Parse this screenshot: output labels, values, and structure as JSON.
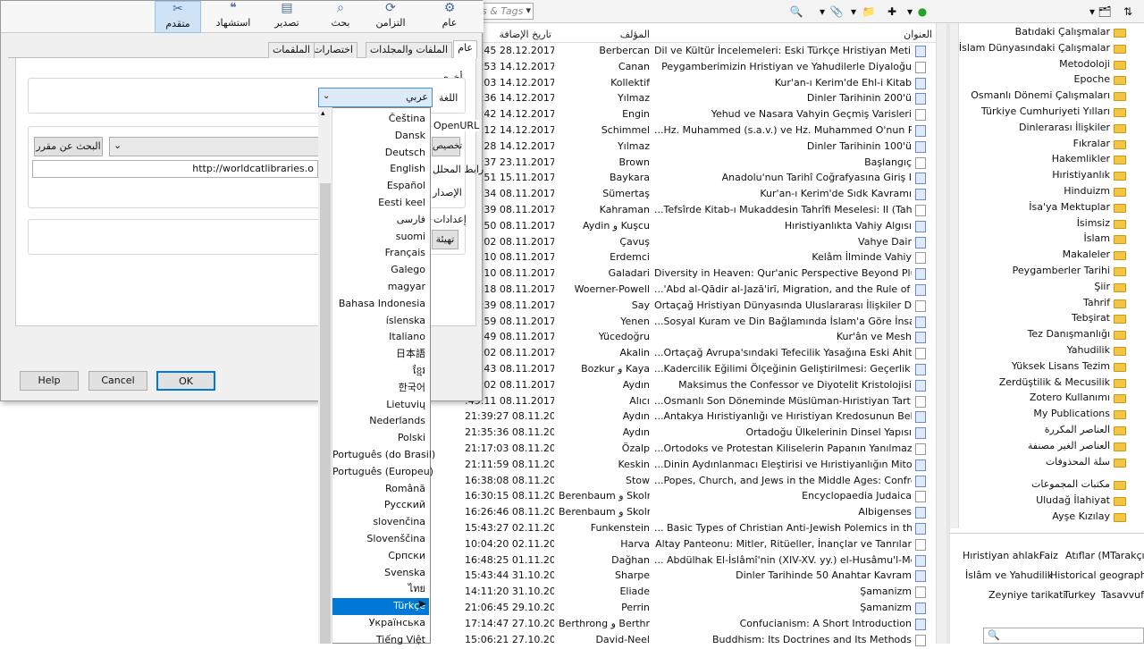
{
  "main": {
    "search_placeholder": "ds & Tags",
    "columns": {
      "title": "العنوان",
      "author": "المؤلف",
      "date_added": "تاريخ الإضافة"
    },
    "rows": [
      {
        "date": ":46:45 28.12.2017",
        "author": "Berbercan",
        "title": "Dil ve Kültür İncelemeleri: Eski Türkçe Hristiyan Metinleri"
      },
      {
        "date": ":01:53 14.12.2017",
        "author": "Canan",
        "title": "Peygamberimizin Hristiyan ve Yahudilerle Diyaloğu"
      },
      {
        "date": ":01:03 14.12.2017",
        "author": "Kollektif",
        "title": "Kur'an-ı Kerim'de Ehl-i Kitab"
      },
      {
        "date": ":00:36 14.12.2017",
        "author": "Yılmaz",
        "title": "Dinler Tarihinin 200'ü"
      },
      {
        "date": ":58:42 14.12.2017",
        "author": "Engin",
        "title": "Yehud ve Nasara Vahyin Geçmiş Varisleri"
      },
      {
        "date": ":57:12 14.12.2017",
        "author": "Schimmel",
        "title": "...Hz. Muhammed (s.a.v.) ve Hz. Muhammed O'nun Peygam"
      },
      {
        "date": ":55:28 14.12.2017",
        "author": "Yılmaz",
        "title": "Dinler Tarihinin 100'ü"
      },
      {
        "date": ":08:37 23.11.2017",
        "author": "Brown",
        "title": "Başlangıç"
      },
      {
        "date": ":21:51 15.11.2017",
        "author": "Baykara",
        "title": "Anadolu'nun Tarihî Coğrafyasına Giriş I"
      },
      {
        "date": ":01:34 08.11.2017",
        "author": "Sümertaş",
        "title": "Kur'an-ı Kerim'de Sıdk Kavramı"
      },
      {
        "date": ":58:39 08.11.2017",
        "author": "Kahraman",
        "title": "...Tefsîrde Kitab-ı Mukaddesin Tahrîfi Meselesi: II (Tahrîf Keli"
      },
      {
        "date": ":55:50 08.11.2017",
        "author": "Aydin و Kuşcu",
        "title": "Hıristiyanlıkta Vahiy Algısı"
      },
      {
        "date": ":55:02 08.11.2017",
        "author": "Çavuş",
        "title": "Vahye Dair"
      },
      {
        "date": ":53:10 08.11.2017",
        "author": "Erdemci",
        "title": "Kelâm İlminde Vahiy"
      },
      {
        "date": ":44:10 08.11.2017",
        "author": "Galadari",
        "title": "Diversity in Heaven: Qur'anic Perspective Beyond Pluralism"
      },
      {
        "date": ":43:18 08.11.2017",
        "author": "Woerner-Powell",
        "title": "...'Abd al-Qādir al-Jazā'irī, Migration, and the Rule of Law: 'A"
      },
      {
        "date": ":39:39 08.11.2017",
        "author": "Say",
        "title": "Ortaçağ Hristiyan Dünyasında Uluslararası İlişkiler Düşüncesi"
      },
      {
        "date": ":37:59 08.11.2017",
        "author": "Yenen",
        "title": "...Sosyal Kuram ve Din Bağlamında İslam'a Göre İnsanın Tem"
      },
      {
        "date": ":34:49 08.11.2017",
        "author": "Yücedoğru",
        "title": "Kur'ân ve Mesh"
      },
      {
        "date": ":31:02 08.11.2017",
        "author": "Akalin",
        "title": "...Ortaçağ Avrupa'sındaki Tefecilik Yasağına Eski Ahit Metinle"
      },
      {
        "date": ":48:43 08.11.2017",
        "author": "Bozkur و Kaya",
        "title": "...Kadercilik Eğilimi Ölçeğinin Geliştirilmesi: Geçerlik Ve Güve"
      },
      {
        "date": ":47:02 08.11.2017",
        "author": "Aydın",
        "title": "Maksimus the Confessor ve Diyotelit Kristolojisi"
      },
      {
        "date": ":45:11 08.11.2017",
        "author": "Alıcı",
        "title": "...Osmanlı Son Döneminde Müslüman-Hıristiyan Tartışmaları"
      },
      {
        "date": "21:39:27 08.11.2017",
        "author": "Aydın",
        "title": "...Antakya Hıristiyanlığı ve Hıristiyan Kredosunun Belirlenmesi"
      },
      {
        "date": "21:35:36 08.11.2017",
        "author": "Aydın",
        "title": "Ortadoğu Ülkelerinin Dinsel Yapısı"
      },
      {
        "date": "21:17:03 08.11.2017",
        "author": "Özalp",
        "title": "...Ortodoks ve Protestan Kiliselerin Papanın Yanılmazlığı Dokt"
      },
      {
        "date": "21:11:59 08.11.2017",
        "author": "Keskin",
        "title": "...Dinin Aydınlanmacı Eleştirisi ve Hıristiyanlığın Mitolojik Kar"
      },
      {
        "date": "16:38:08 08.11.2017",
        "author": "Stow",
        "title": "...Popes, Church, and Jews in the Middle Ages: Confrontation"
      },
      {
        "date": "16:30:15 08.11.2017",
        "author": "Berenbaum و Skolnik",
        "title": "Encyclopaedia Judaica"
      },
      {
        "date": "16:26:46 08.11.2017",
        "author": "Berenbaum و Skolnik",
        "title": "Albigenses"
      },
      {
        "date": "15:43:27 02.11.2017",
        "author": "Funkenstein",
        "title": "... Basic Types of Christian Anti-Jewish Polemics in the Later"
      },
      {
        "date": "10:04:20 02.11.2017",
        "author": "Harva",
        "title": "Altay Panteonu: Mitler, Ritüeller, İnançlar ve Tanrılar"
      },
      {
        "date": "16:48:25 01.11.2017",
        "author": "Dağhan",
        "title": "... Abdülhak El-İslâmî'nin (XIV-XV. yy.) el-Husâmu'l-Memdûd"
      },
      {
        "date": "15:43:44 31.10.2017",
        "author": "Sharpe",
        "title": "Dinler Tarihinde 50 Anahtar Kavram"
      },
      {
        "date": "14:11:20 31.10.2017",
        "author": "Eliade",
        "title": "Şamanizm"
      },
      {
        "date": "21:06:45 29.10.2017",
        "author": "Perrin",
        "title": "Şamanizm"
      },
      {
        "date": "17:14:47 27.10.2017",
        "author": "Berthrong و Berthrong",
        "title": "Confucianism: A Short Introduction"
      },
      {
        "date": "15:06:21 27.10.2017",
        "author": "David-Neel",
        "title": "Buddhism: Its Doctrines and Its Methods"
      }
    ],
    "collections": [
      "Batıdaki Çalışmalar",
      "İslam Dünyasındaki Çalışmalar",
      "Metodoloji",
      "Epoche",
      "Osmanlı Dönemi Çalışmaları",
      "Türkiye Cumhuriyeti Yılları",
      "Dinlerarası İlişkiler",
      "Fıkralar",
      "Hakemlikler",
      "Hıristiyanlık",
      "Hinduizm",
      "İsa'ya Mektuplar",
      "İsimsiz",
      "İslam",
      "Makaleler",
      "Peygamberler Tarihi",
      "Şiir",
      "Tahrif",
      "Tebşirat",
      "Tez Danışmanlığı",
      "Yahudilik",
      "Yüksek Lisans Tezim",
      "Zerdüştilik & Mecusilik",
      "Zotero Kullanımı",
      "My Publications",
      "العناصر المكررة",
      "العناصر الغير مصنفة",
      "سلة المحذوفات",
      "مكتبات المجموعات",
      "Uludağ İlahiyat",
      "Ayşe Kızılay"
    ],
    "tags": [
      "Hıristiyan ahlakı",
      "Faiz",
      "Atıflar (MTarakçı)",
      "İslâm ve Yahudilik",
      "Historical geography",
      "Zeyniye tarikatı",
      "Turkey",
      "Tasavvuf"
    ]
  },
  "dialog": {
    "tabs": [
      "عام",
      "التزامن",
      "بحث",
      "تصدير",
      "استشهاد",
      "متقدم"
    ],
    "subtabs": [
      "عام",
      "الملفات والمجلدات",
      "اختصارات",
      "الملقمات"
    ],
    "group_other": "أخرى",
    "language_label": "اللغة",
    "language_value": "عربي",
    "openurl_label": "OpenURL",
    "resolver_label": "تخصيص",
    "resolver_url_label": "رابط المحلل",
    "version_label": "الإصدار",
    "settings_label": "إعدادات",
    "reset_label": "تهيئة",
    "search_resolver_button": "البحث عن مقرر",
    "resolver_url": "http://worldcatlibraries.o",
    "help_button": "Help",
    "cancel_button": "Cancel",
    "ok_button": "OK"
  },
  "languages": [
    "Čeština",
    "Dansk",
    "Deutsch",
    "English",
    "Español",
    "Eesti keel",
    "فارسی",
    "suomi",
    "Français",
    "Galego",
    "magyar",
    "Bahasa Indonesia",
    "íslenska",
    "Italiano",
    "日本語",
    "ខ្មែរ",
    "한국어",
    "Lietuvių",
    "Nederlands",
    "Polski",
    "Português (do Brasil)",
    "Português (Europeu)",
    "Română",
    "Русский",
    "slovenčina",
    "Slovenščina",
    "Српски",
    "Svenska",
    "ไทย",
    "Türkçe",
    "Українська",
    "Tiếng Việt"
  ],
  "selected_language_index": 29
}
